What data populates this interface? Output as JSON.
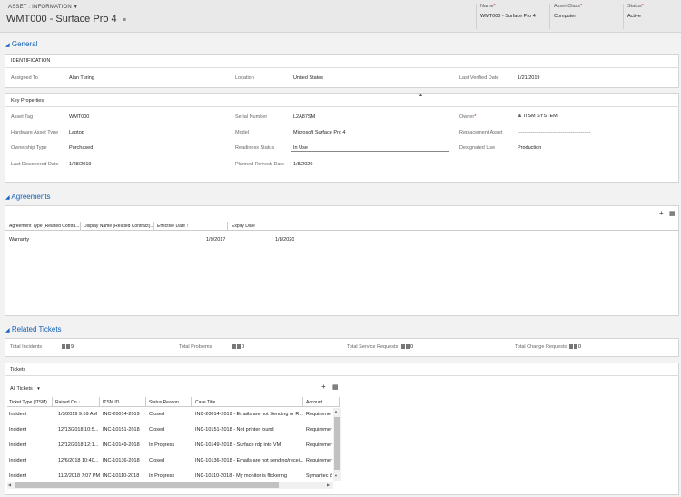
{
  "header": {
    "entity_type": "ASSET : INFORMATION",
    "title": "WMT000 - Surface Pro 4",
    "fields": [
      {
        "label": "Name",
        "value": "WMT000 - Surface Pro 4"
      },
      {
        "label": "Asset Class",
        "value": "Computer"
      },
      {
        "label": "Status",
        "value": "Active"
      }
    ]
  },
  "general": {
    "section_title": "General",
    "identification": {
      "title": "IDENTIFICATION",
      "assigned_to_label": "Assigned To",
      "assigned_to_value": "Alan Turing",
      "location_label": "Location",
      "location_value": "United States",
      "last_verified_label": "Last Verified Date",
      "last_verified_value": "1/21/2019"
    },
    "key_properties": {
      "title": "Key Properties",
      "asset_tag_label": "Asset Tag",
      "asset_tag_value": "WMT000",
      "serial_label": "Serial Number",
      "serial_value": "L2A87SM",
      "owner_label": "Owner",
      "owner_value": "ITSM SYSTEM",
      "hw_type_label": "Hardware Asset Type",
      "hw_type_value": "Laptop",
      "model_label": "Model",
      "model_value": "Microsoft Surface Pro 4",
      "replacement_label": "Replacement Asset",
      "replacement_value": "--------------------------------------------",
      "ownership_label": "Ownership Type",
      "ownership_value": "Purchased",
      "readiness_label": "Readiness Status",
      "readiness_value": "In Use",
      "designated_label": "Designated Use",
      "designated_value": "Production",
      "last_discovered_label": "Last Discovered Date",
      "last_discovered_value": "1/28/2019",
      "refresh_label": "Planned Refresh Date",
      "refresh_value": "1/8/2020"
    }
  },
  "agreements": {
    "section_title": "Agreements",
    "columns": [
      "Agreement Type (Related Contra...",
      "Display Name (Related Contract)...",
      "Effective Date ↑",
      "Expiry Date"
    ],
    "rows": [
      {
        "type": "Warranty",
        "name": "",
        "effective": "1/9/2017",
        "expiry": "1/8/2020"
      }
    ]
  },
  "related_tickets": {
    "section_title": "Related Tickets",
    "counters": [
      {
        "label": "Total Incidents",
        "value": "9"
      },
      {
        "label": "Total Problems",
        "value": "0"
      },
      {
        "label": "Total Service Requests",
        "value": "0"
      },
      {
        "label": "Total Change Requests",
        "value": "0"
      }
    ]
  },
  "tickets": {
    "title": "Tickets",
    "view_selector": "All Tickets",
    "columns": [
      "Ticket Type (ITSM)",
      "Raised On ↓",
      "ITSM ID",
      "Status Reason",
      "Case Title",
      "Account"
    ],
    "rows": [
      {
        "type": "Incident",
        "raised": "1/3/2019 9:59 AM",
        "id": "INC-20014-2019",
        "status": "Closed",
        "title": "INC-20014-2019 - Emails are not Sending or R...",
        "account": "Requiremen"
      },
      {
        "type": "Incident",
        "raised": "12/13/2018 10:5...",
        "id": "INC-10151-2018",
        "status": "Closed",
        "title": "INC-10151-2018 - Not printer found",
        "account": "Requiremen"
      },
      {
        "type": "Incident",
        "raised": "12/12/2018 12:1...",
        "id": "INC-10149-2018",
        "status": "In Progress",
        "title": "INC-10149-2018 - Surface rdp into VM",
        "account": "Requiremen"
      },
      {
        "type": "Incident",
        "raised": "12/6/2018 10:40...",
        "id": "INC-10136-2018",
        "status": "Closed",
        "title": "INC-10136-2018 - Emails are not sending/recei...",
        "account": "Requiremen"
      },
      {
        "type": "Incident",
        "raised": "11/2/2018 7:07 PM",
        "id": "INC-10110-2018",
        "status": "In Progress",
        "title": "INC-10110-2018 - My monitor is flickering",
        "account": "Symantec (S"
      }
    ]
  }
}
